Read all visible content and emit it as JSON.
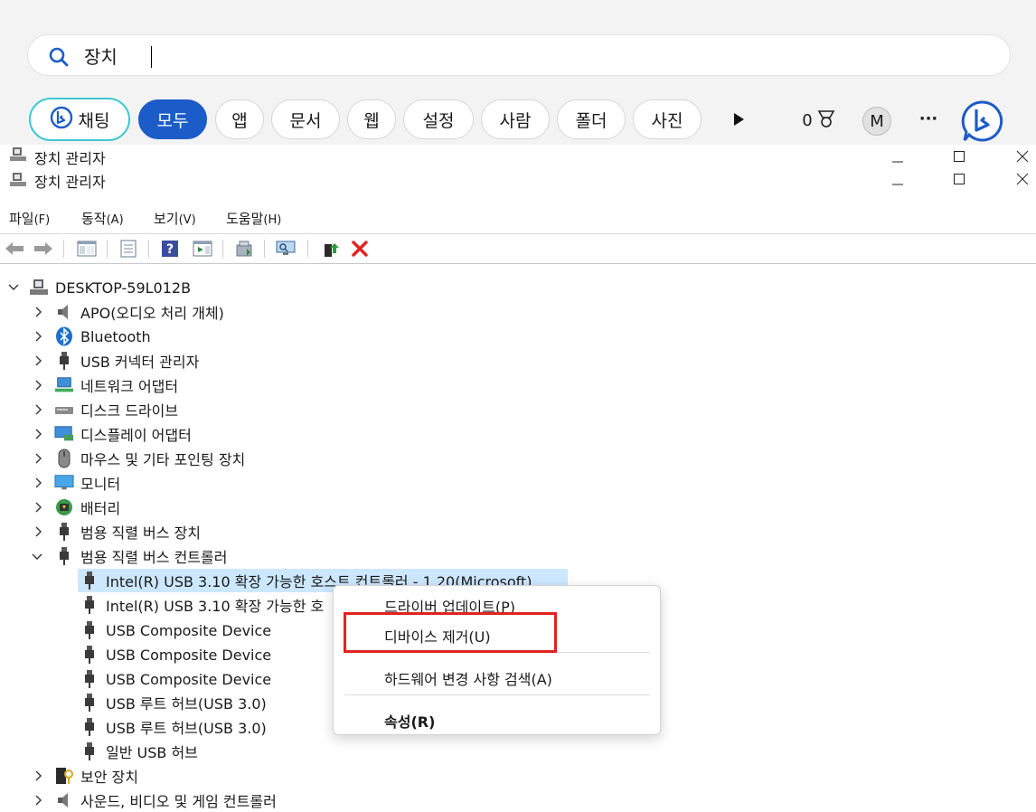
{
  "search": {
    "query": "장치"
  },
  "filters": {
    "chat": "채팅",
    "chips": [
      "모두",
      "앱",
      "문서",
      "웹",
      "설정",
      "사람",
      "폴더",
      "사진"
    ],
    "points": "0",
    "avatar_letter": "M",
    "more": "···"
  },
  "window": {
    "title": "장치 관리자",
    "title_ghost": "장치 관리자"
  },
  "menu": [
    {
      "label": "파일",
      "accel": "(F)"
    },
    {
      "label": "동작",
      "accel": "(A)"
    },
    {
      "label": "보기",
      "accel": "(V)"
    },
    {
      "label": "도움말",
      "accel": "(H)"
    }
  ],
  "tree": {
    "root": "DESKTOP-59L012B",
    "categories": [
      "APO(오디오 처리 개체)",
      "Bluetooth",
      "USB 커넥터 관리자",
      "네트워크 어댑터",
      "디스크 드라이브",
      "디스플레이 어댑터",
      "마우스 및 기타 포인팅 장치",
      "모니터",
      "배터리",
      "범용 직렬 버스 장치",
      "범용 직렬 버스 컨트롤러"
    ],
    "controller_children": [
      "Intel(R) USB 3.10 확장 가능한 호스트 컨트롤러 - 1.20(Microsoft)",
      "Intel(R) USB 3.10 확장 가능한 호",
      "USB Composite Device",
      "USB Composite Device",
      "USB Composite Device",
      "USB 루트 허브(USB 3.0)",
      "USB 루트 허브(USB 3.0)",
      "일반 USB 허브"
    ],
    "after": [
      "보안 장치",
      "사운드, 비디오 및 게임 컨트롤러"
    ]
  },
  "context_menu": {
    "update_driver": "드라이버 업데이트(P)",
    "uninstall": "디바이스 제거(U)",
    "scan": "하드웨어 변경 사항 검색(A)",
    "properties": "속성(R)"
  },
  "colors": {
    "accent": "#1c5cc9",
    "chat_ring": "#3ec8d2",
    "selection": "#cce8ff",
    "highlight": "#e0231f"
  }
}
